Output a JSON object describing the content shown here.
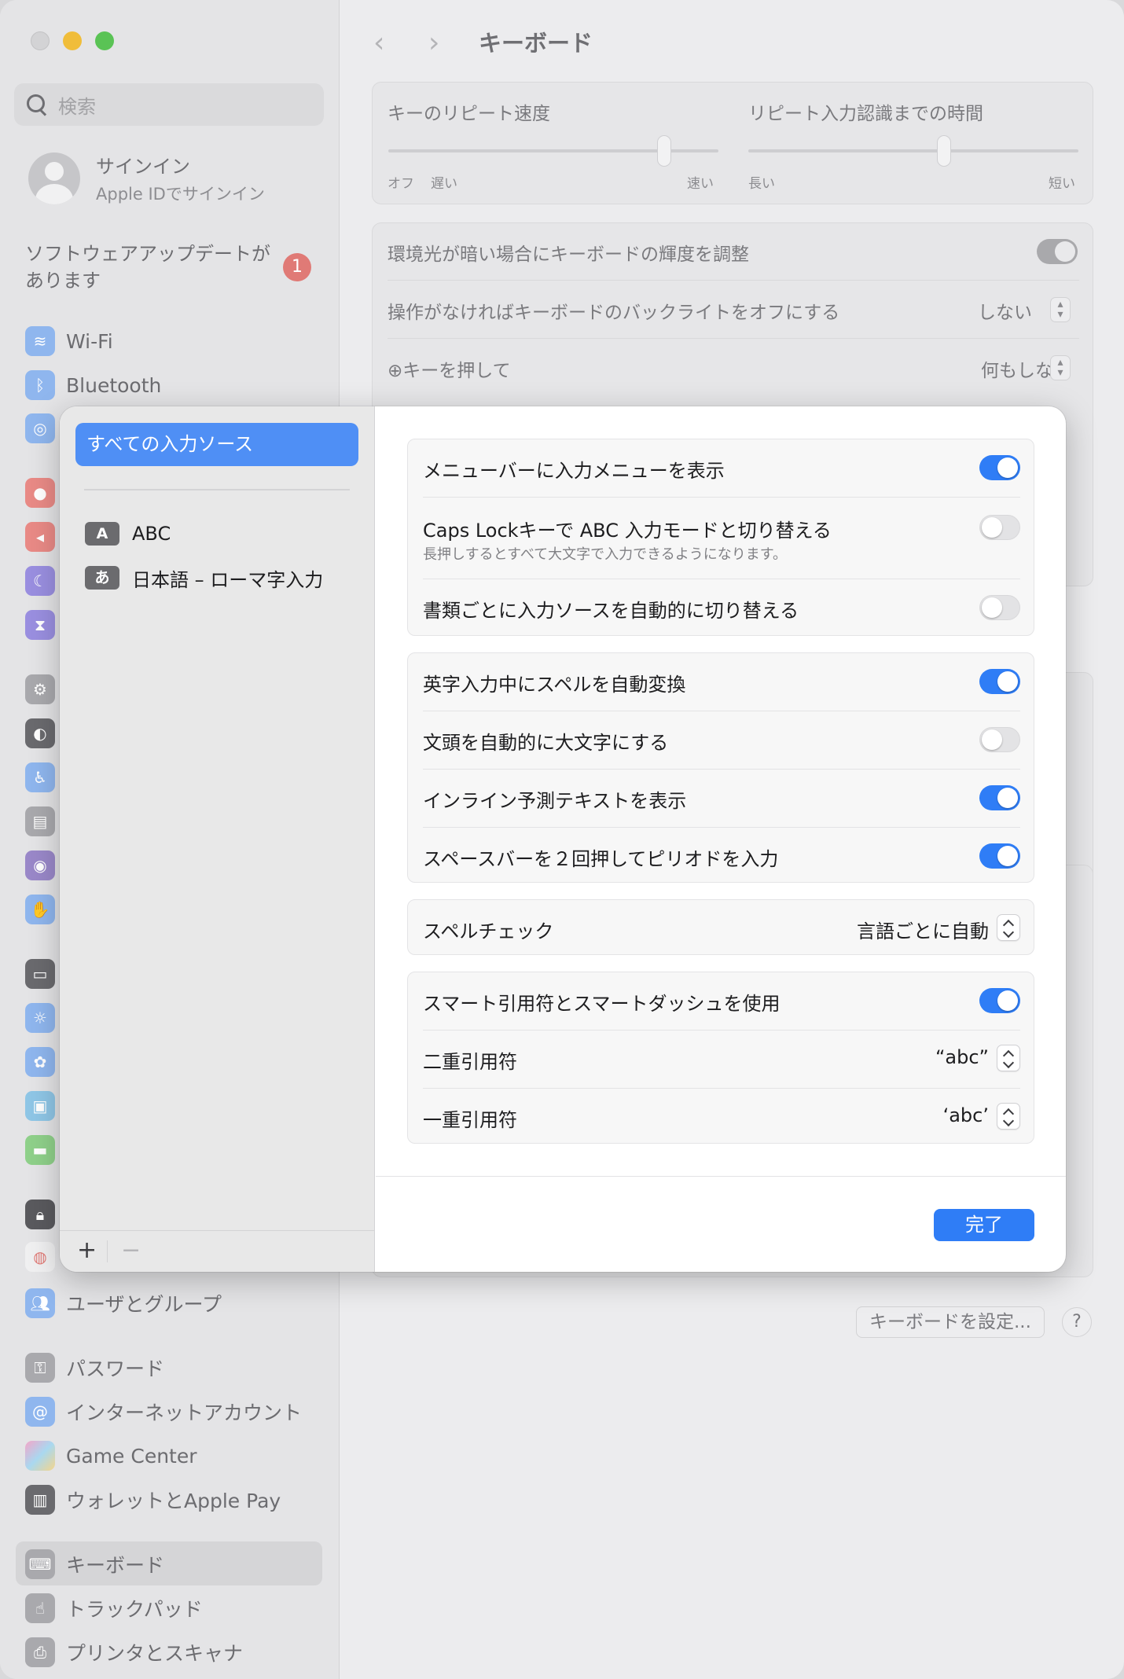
{
  "sidebar": {
    "search_placeholder": "検索",
    "account": {
      "title": "サインイン",
      "subtitle": "Apple IDでサインイン"
    },
    "update": {
      "label": "ソフトウェアアップデートがあります",
      "badge": "1"
    },
    "items": {
      "wifi": "Wi-Fi",
      "bluetooth": "Bluetooth",
      "users": "ユーザとグループ",
      "passwords": "パスワード",
      "internet_accounts": "インターネットアカウント",
      "game_center": "Game Center",
      "wallet": "ウォレットとApple Pay",
      "keyboard": "キーボード",
      "trackpad": "トラックパッド",
      "printers": "プリンタとスキャナ"
    }
  },
  "main": {
    "title": "キーボード",
    "key_repeat": {
      "label": "キーのリピート速度",
      "left1": "オフ",
      "left2": "遅い",
      "right": "速い"
    },
    "repeat_delay": {
      "label": "リピート入力認識までの時間",
      "left": "長い",
      "right": "短い"
    },
    "brightness_label": "環境光が暗い場合にキーボードの輝度を調整",
    "backlight": {
      "label": "操作がなければキーボードのバックライトをオフにする",
      "value": "しない"
    },
    "globe": {
      "label": "キーを押して",
      "value": "何もしない"
    },
    "setup_button": "キーボードを設定...",
    "help_button": "?"
  },
  "sheet": {
    "sources": {
      "all": "すべての入力ソース",
      "abc": {
        "icon": "A",
        "label": "ABC"
      },
      "japanese": {
        "icon": "あ",
        "label": "日本語 – ローマ字入力"
      }
    },
    "add_button": "+",
    "remove_button": "−",
    "group1": {
      "show_menu": "メニューバーに入力メニューを表示",
      "caps_lock": "Caps Lockキーで ABC 入力モードと切り替える",
      "caps_lock_sub": "長押しするとすべて大文字で入力できるようになります。",
      "auto_switch": "書類ごとに入力ソースを自動的に切り替える"
    },
    "group2": {
      "auto_correct": "英字入力中にスペルを自動変換",
      "auto_capitalize": "文頭を自動的に大文字にする",
      "inline_predict": "インライン予測テキストを表示",
      "double_space": "スペースバーを２回押してピリオドを入力"
    },
    "spellcheck": {
      "label": "スペルチェック",
      "value": "言語ごとに自動"
    },
    "group4": {
      "smart_quotes": "スマート引用符とスマートダッシュを使用",
      "double_quote": {
        "label": "二重引用符",
        "value": "“abc”"
      },
      "single_quote": {
        "label": "一重引用符",
        "value": "‘abc’"
      }
    },
    "done_button": "完了"
  }
}
